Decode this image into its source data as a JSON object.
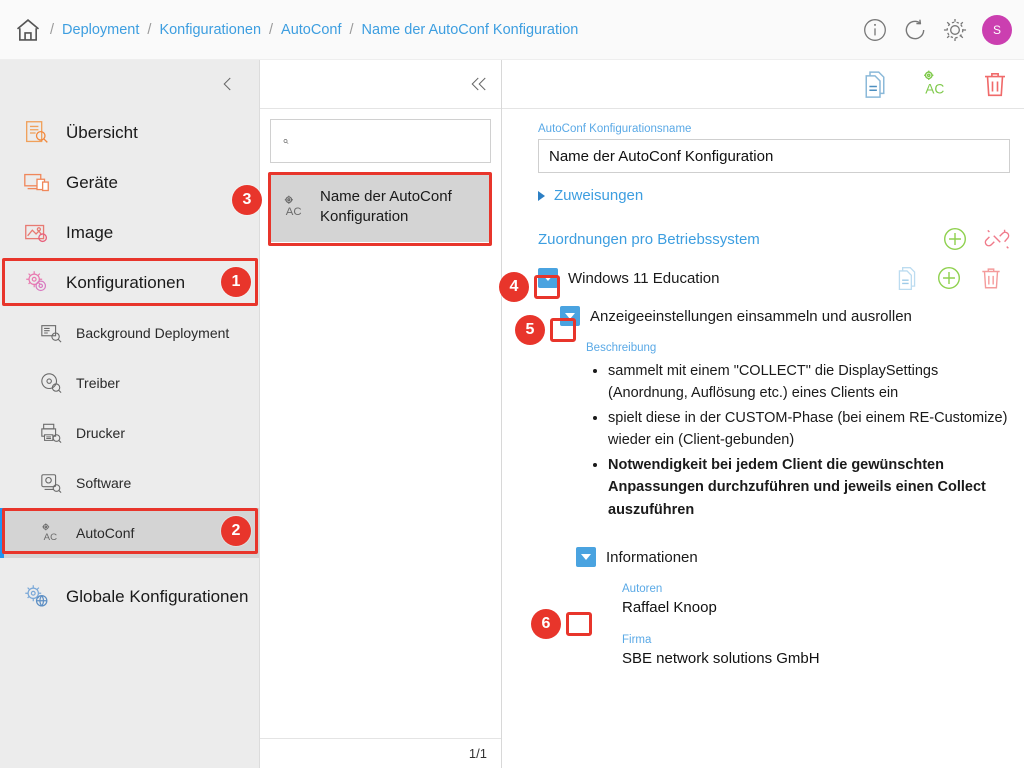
{
  "topbar": {
    "home_icon": "home-icon",
    "breadcrumbs": [
      "Deployment",
      "Konfigurationen",
      "AutoConf",
      "Name der AutoConf Konfiguration"
    ],
    "separator": "/",
    "info_icon": "info-icon",
    "refresh_icon": "refresh-icon",
    "settings_icon": "gear-icon",
    "avatar_initial": "S",
    "avatar_color": "#cb3fb0",
    "link_color": "#3d9ee0"
  },
  "sidebar": {
    "collapse_icon": "chevron-left-icon",
    "items": [
      {
        "label": "Übersicht",
        "icon": "overview-icon",
        "level": 1
      },
      {
        "label": "Geräte",
        "icon": "devices-icon",
        "level": 1
      },
      {
        "label": "Image",
        "icon": "image-icon",
        "level": 1
      },
      {
        "label": "Konfigurationen",
        "icon": "configurations-icon",
        "level": 1
      },
      {
        "label": "Background Deployment",
        "icon": "background-deployment-icon",
        "level": 2
      },
      {
        "label": "Treiber",
        "icon": "driver-icon",
        "level": 2
      },
      {
        "label": "Drucker",
        "icon": "printer-icon",
        "level": 2
      },
      {
        "label": "Software",
        "icon": "software-icon",
        "level": 2
      },
      {
        "label": "AutoConf",
        "icon": "autoconf-icon",
        "level": 2
      },
      {
        "label": "Globale Konfigurationen",
        "icon": "global-configurations-icon",
        "level": 1
      }
    ]
  },
  "list_panel": {
    "collapse_icon": "chevron-left-icon",
    "search": {
      "value": "",
      "placeholder": "",
      "icon": "search-icon"
    },
    "items": [
      {
        "label": "Name der AutoConf Konfiguration",
        "icon": "autoconf-icon",
        "selected": true
      }
    ],
    "pagination": "1/1"
  },
  "detail": {
    "toolbar": {
      "collapse_icon": "chevron-left-icon",
      "copy_icon": "copy-document-icon",
      "autoconf_icon": "autoconf-icon",
      "delete_icon": "trash-icon"
    },
    "name_field": {
      "label": "AutoConf Konfigurationsname",
      "value": "Name der AutoConf Konfiguration"
    },
    "assignments_accordion": {
      "label": "Zuweisungen",
      "expanded": false
    },
    "os_section": {
      "title": "Zuordnungen pro Betriebssystem",
      "add_icon": "plus-circle-icon",
      "unlink_icon": "broken-link-icon"
    },
    "os_entry": {
      "title": "Windows 11 Education",
      "expanded": true,
      "copy_icon": "copy-document-icon",
      "add_icon": "plus-circle-icon",
      "delete_icon": "trash-icon"
    },
    "sub_entry": {
      "title": "Anzeigeeinstellungen einsammeln und ausrollen",
      "expanded": true
    },
    "description": {
      "label": "Beschreibung",
      "bullets": [
        {
          "text": "sammelt mit einem \"COLLECT\" die DisplaySettings (Anordnung, Auflösung etc.) eines Clients ein",
          "bold": false
        },
        {
          "text": "spielt diese in der CUSTOM-Phase (bei einem RE-Customize) wieder ein (Client-gebunden)",
          "bold": false
        },
        {
          "text": "Notwendigkeit bei jedem Client die gewünschten Anpassungen durchzuführen und jeweils einen Collect auszuführen",
          "bold": true
        }
      ]
    },
    "information": {
      "title": "Informationen",
      "expanded": true,
      "fields": [
        {
          "label": "Autoren",
          "value": "Raffael Knoop"
        },
        {
          "label": "Firma",
          "value": "SBE network solutions GmbH"
        }
      ]
    }
  },
  "annotations": {
    "color": "#e8352b",
    "badges": [
      {
        "number": "1",
        "target": "sidebar-item-konfigurationen"
      },
      {
        "number": "2",
        "target": "sidebar-item-autoconf"
      },
      {
        "number": "3",
        "target": "list-item-autoconf-config"
      },
      {
        "number": "4",
        "target": "os-entry-toggle"
      },
      {
        "number": "5",
        "target": "sub-entry-toggle"
      },
      {
        "number": "6",
        "target": "information-toggle"
      }
    ]
  }
}
